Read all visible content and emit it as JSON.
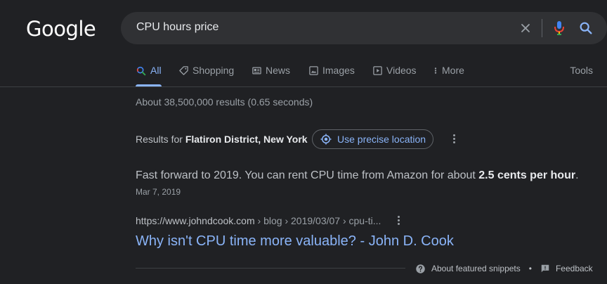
{
  "logo": {
    "text": "Google"
  },
  "search": {
    "query": "CPU hours price"
  },
  "tabs": [
    {
      "label": "All",
      "icon": "search-icon",
      "active": true
    },
    {
      "label": "Shopping",
      "icon": "tag-icon"
    },
    {
      "label": "News",
      "icon": "news-icon"
    },
    {
      "label": "Images",
      "icon": "image-icon"
    },
    {
      "label": "Videos",
      "icon": "video-icon"
    },
    {
      "label": "More",
      "icon": "more-vert-icon"
    }
  ],
  "tools_label": "Tools",
  "stats": "About 38,500,000 results (0.65 seconds)",
  "location": {
    "prefix": "Results for ",
    "place": "Flatiron District, New York",
    "button_label": "Use precise location"
  },
  "featured": {
    "text_before": "Fast forward to 2019. You can rent CPU time from Amazon for about ",
    "text_bold": "2.5 cents per hour",
    "text_after": ".",
    "date": "Mar 7, 2019",
    "cite_domain": "https://www.johndcook.com",
    "cite_path": " › blog › 2019/03/07 › cpu-ti...",
    "title": "Why isn't CPU time more valuable? - John D. Cook"
  },
  "footer": {
    "about_label": "About featured snippets",
    "separator": "•",
    "feedback_label": "Feedback"
  },
  "colors": {
    "accent": "#8ab4f8",
    "background": "#202124"
  }
}
